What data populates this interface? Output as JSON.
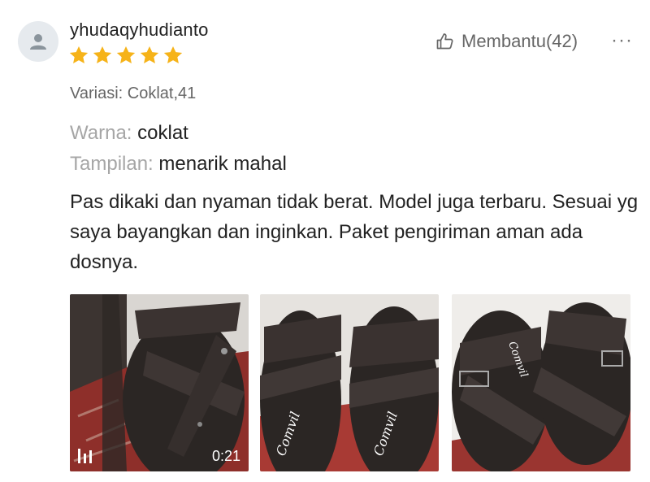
{
  "review": {
    "username": "yhudaqyhudianto",
    "rating": 5,
    "helpful_label": "Membantu(42)",
    "more_label": "···",
    "variant": "Variasi: Coklat,41",
    "attributes": [
      {
        "key": "Warna:",
        "value": "coklat"
      },
      {
        "key": "Tampilan:",
        "value": "menarik mahal"
      }
    ],
    "text": "Pas dikaki dan nyaman tidak berat. Model juga terbaru. Sesuai yg saya bayangkan dan inginkan. Paket pengiriman aman ada dosnya.",
    "media": [
      {
        "type": "video",
        "duration": "0:21"
      },
      {
        "type": "image"
      },
      {
        "type": "image"
      }
    ]
  },
  "colors": {
    "star": "#f6b319",
    "muted_text": "#a6a6a6",
    "sandal": "#2b2624"
  },
  "icons": [
    "user-icon",
    "star-icon",
    "thumbs-up-icon",
    "more-icon",
    "video-icon"
  ]
}
